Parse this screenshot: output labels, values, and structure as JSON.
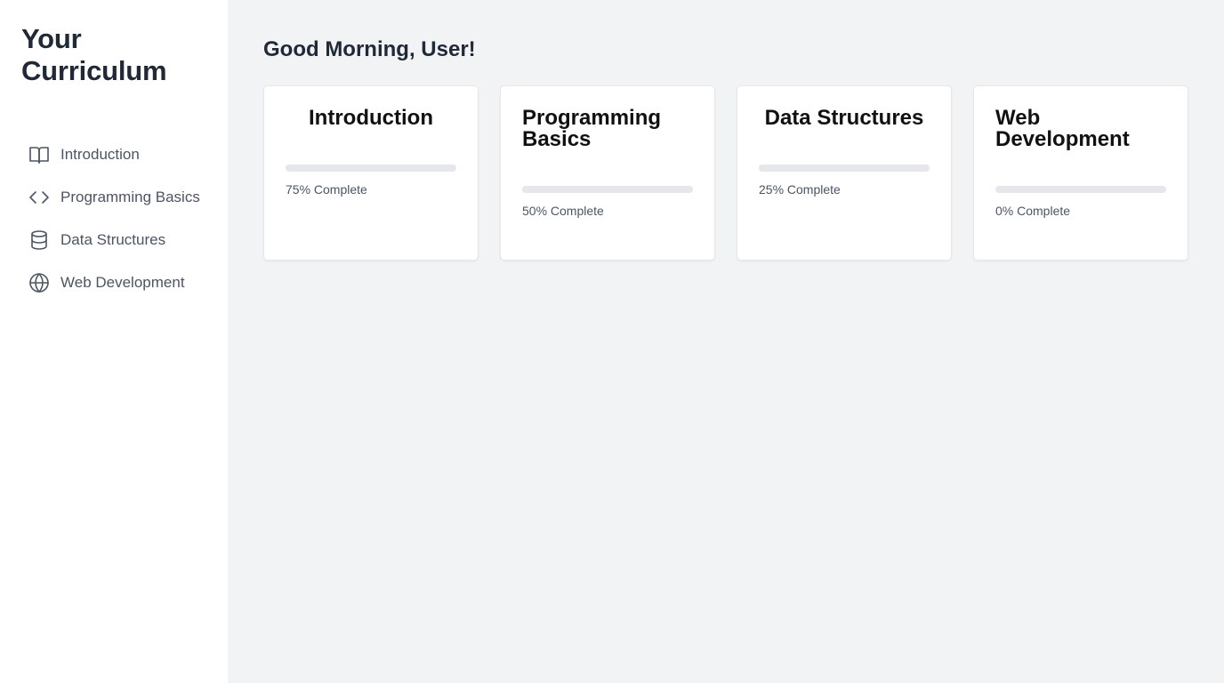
{
  "sidebar": {
    "title": "Your Curriculum",
    "items": [
      {
        "label": "Introduction",
        "icon": "book-open-icon"
      },
      {
        "label": "Programming Basics",
        "icon": "code-icon"
      },
      {
        "label": "Data Structures",
        "icon": "database-icon"
      },
      {
        "label": "Web Development",
        "icon": "globe-icon"
      }
    ]
  },
  "main": {
    "greeting": "Good Morning, User!",
    "cards": [
      {
        "title": "Introduction",
        "progress": 75,
        "progress_label": "75% Complete"
      },
      {
        "title": "Programming Basics",
        "progress": 50,
        "progress_label": "50% Complete"
      },
      {
        "title": "Data Structures",
        "progress": 25,
        "progress_label": "25% Complete"
      },
      {
        "title": "Web Development",
        "progress": 0,
        "progress_label": "0% Complete"
      }
    ]
  },
  "colors": {
    "sidebar_bg": "#ffffff",
    "main_bg": "#f2f3f5",
    "text_primary": "#1f2937",
    "text_secondary": "#4b5563",
    "progress_track": "#e5e7eb"
  }
}
